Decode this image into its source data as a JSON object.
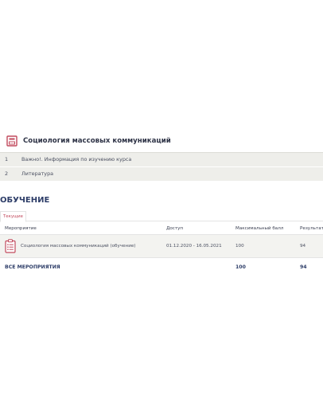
{
  "course": {
    "title": "Социология массовых коммуникаций",
    "items": [
      {
        "num": "1",
        "label": "Важно!. Информация по изучению курса"
      },
      {
        "num": "2",
        "label": "Литература"
      }
    ]
  },
  "training": {
    "title": "ОБУЧЕНИЕ",
    "tab": "Текущие",
    "columns": [
      "Мероприятие",
      "Доступ",
      "Максимальный балл",
      "Результат"
    ],
    "rows": [
      {
        "event": "Социология массовых коммуникаций (обучение)",
        "access": "01.12.2020 - 16.05.2021",
        "max_score": "100",
        "result": "94"
      }
    ],
    "total": {
      "label": "ВСЕ МЕРОПРИЯТИЯ",
      "max_score": "100",
      "result": "94"
    }
  },
  "colors": {
    "accent_red": "#c24a5d",
    "title_blue": "#2d3d68",
    "row_bg": "#eeeeea"
  },
  "icons": {
    "course": "book-icon",
    "event": "clipboard-list-icon"
  }
}
